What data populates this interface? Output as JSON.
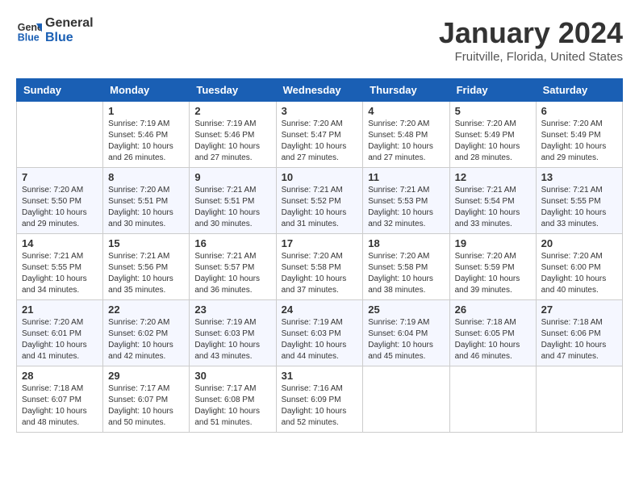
{
  "header": {
    "logo_line1": "General",
    "logo_line2": "Blue",
    "title": "January 2024",
    "subtitle": "Fruitville, Florida, United States"
  },
  "calendar": {
    "days_of_week": [
      "Sunday",
      "Monday",
      "Tuesday",
      "Wednesday",
      "Thursday",
      "Friday",
      "Saturday"
    ],
    "weeks": [
      [
        {
          "day": "",
          "info": ""
        },
        {
          "day": "1",
          "info": "Sunrise: 7:19 AM\nSunset: 5:46 PM\nDaylight: 10 hours\nand 26 minutes."
        },
        {
          "day": "2",
          "info": "Sunrise: 7:19 AM\nSunset: 5:46 PM\nDaylight: 10 hours\nand 27 minutes."
        },
        {
          "day": "3",
          "info": "Sunrise: 7:20 AM\nSunset: 5:47 PM\nDaylight: 10 hours\nand 27 minutes."
        },
        {
          "day": "4",
          "info": "Sunrise: 7:20 AM\nSunset: 5:48 PM\nDaylight: 10 hours\nand 27 minutes."
        },
        {
          "day": "5",
          "info": "Sunrise: 7:20 AM\nSunset: 5:49 PM\nDaylight: 10 hours\nand 28 minutes."
        },
        {
          "day": "6",
          "info": "Sunrise: 7:20 AM\nSunset: 5:49 PM\nDaylight: 10 hours\nand 29 minutes."
        }
      ],
      [
        {
          "day": "7",
          "info": "Sunrise: 7:20 AM\nSunset: 5:50 PM\nDaylight: 10 hours\nand 29 minutes."
        },
        {
          "day": "8",
          "info": "Sunrise: 7:20 AM\nSunset: 5:51 PM\nDaylight: 10 hours\nand 30 minutes."
        },
        {
          "day": "9",
          "info": "Sunrise: 7:21 AM\nSunset: 5:51 PM\nDaylight: 10 hours\nand 30 minutes."
        },
        {
          "day": "10",
          "info": "Sunrise: 7:21 AM\nSunset: 5:52 PM\nDaylight: 10 hours\nand 31 minutes."
        },
        {
          "day": "11",
          "info": "Sunrise: 7:21 AM\nSunset: 5:53 PM\nDaylight: 10 hours\nand 32 minutes."
        },
        {
          "day": "12",
          "info": "Sunrise: 7:21 AM\nSunset: 5:54 PM\nDaylight: 10 hours\nand 33 minutes."
        },
        {
          "day": "13",
          "info": "Sunrise: 7:21 AM\nSunset: 5:55 PM\nDaylight: 10 hours\nand 33 minutes."
        }
      ],
      [
        {
          "day": "14",
          "info": "Sunrise: 7:21 AM\nSunset: 5:55 PM\nDaylight: 10 hours\nand 34 minutes."
        },
        {
          "day": "15",
          "info": "Sunrise: 7:21 AM\nSunset: 5:56 PM\nDaylight: 10 hours\nand 35 minutes."
        },
        {
          "day": "16",
          "info": "Sunrise: 7:21 AM\nSunset: 5:57 PM\nDaylight: 10 hours\nand 36 minutes."
        },
        {
          "day": "17",
          "info": "Sunrise: 7:20 AM\nSunset: 5:58 PM\nDaylight: 10 hours\nand 37 minutes."
        },
        {
          "day": "18",
          "info": "Sunrise: 7:20 AM\nSunset: 5:58 PM\nDaylight: 10 hours\nand 38 minutes."
        },
        {
          "day": "19",
          "info": "Sunrise: 7:20 AM\nSunset: 5:59 PM\nDaylight: 10 hours\nand 39 minutes."
        },
        {
          "day": "20",
          "info": "Sunrise: 7:20 AM\nSunset: 6:00 PM\nDaylight: 10 hours\nand 40 minutes."
        }
      ],
      [
        {
          "day": "21",
          "info": "Sunrise: 7:20 AM\nSunset: 6:01 PM\nDaylight: 10 hours\nand 41 minutes."
        },
        {
          "day": "22",
          "info": "Sunrise: 7:20 AM\nSunset: 6:02 PM\nDaylight: 10 hours\nand 42 minutes."
        },
        {
          "day": "23",
          "info": "Sunrise: 7:19 AM\nSunset: 6:03 PM\nDaylight: 10 hours\nand 43 minutes."
        },
        {
          "day": "24",
          "info": "Sunrise: 7:19 AM\nSunset: 6:03 PM\nDaylight: 10 hours\nand 44 minutes."
        },
        {
          "day": "25",
          "info": "Sunrise: 7:19 AM\nSunset: 6:04 PM\nDaylight: 10 hours\nand 45 minutes."
        },
        {
          "day": "26",
          "info": "Sunrise: 7:18 AM\nSunset: 6:05 PM\nDaylight: 10 hours\nand 46 minutes."
        },
        {
          "day": "27",
          "info": "Sunrise: 7:18 AM\nSunset: 6:06 PM\nDaylight: 10 hours\nand 47 minutes."
        }
      ],
      [
        {
          "day": "28",
          "info": "Sunrise: 7:18 AM\nSunset: 6:07 PM\nDaylight: 10 hours\nand 48 minutes."
        },
        {
          "day": "29",
          "info": "Sunrise: 7:17 AM\nSunset: 6:07 PM\nDaylight: 10 hours\nand 50 minutes."
        },
        {
          "day": "30",
          "info": "Sunrise: 7:17 AM\nSunset: 6:08 PM\nDaylight: 10 hours\nand 51 minutes."
        },
        {
          "day": "31",
          "info": "Sunrise: 7:16 AM\nSunset: 6:09 PM\nDaylight: 10 hours\nand 52 minutes."
        },
        {
          "day": "",
          "info": ""
        },
        {
          "day": "",
          "info": ""
        },
        {
          "day": "",
          "info": ""
        }
      ]
    ]
  }
}
